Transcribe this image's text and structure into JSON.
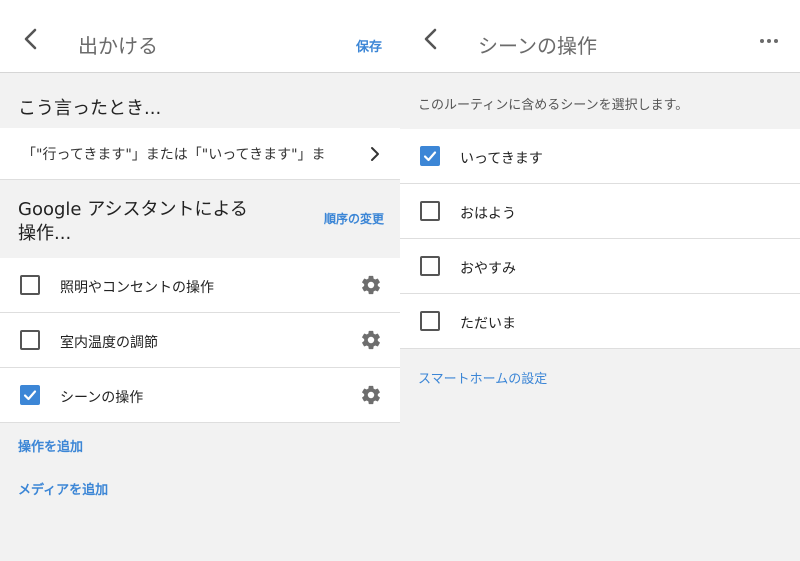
{
  "left": {
    "title": "出かける",
    "save_label": "保存",
    "when_heading": "こう言ったとき...",
    "trigger_text": "「\"行ってきます\"」または「\"いってきます\"」ま",
    "actions_heading_line1": "Google アシスタントによる",
    "actions_heading_line2": "操作...",
    "reorder_label": "順序の変更",
    "actions": [
      {
        "label": "照明やコンセントの操作",
        "checked": false
      },
      {
        "label": "室内温度の調節",
        "checked": false
      },
      {
        "label": "シーンの操作",
        "checked": true
      }
    ],
    "add_action_label": "操作を追加",
    "add_media_label": "メディアを追加"
  },
  "right": {
    "title": "シーンの操作",
    "intro": "このルーティンに含めるシーンを選択します。",
    "scenes": [
      {
        "label": "いってきます",
        "checked": true
      },
      {
        "label": "おはよう",
        "checked": false
      },
      {
        "label": "おやすみ",
        "checked": false
      },
      {
        "label": "ただいま",
        "checked": false
      }
    ],
    "smarthome_link": "スマートホームの設定"
  },
  "colors": {
    "accent": "#3c86d6",
    "background": "#f2f2f2",
    "card": "#ffffff",
    "title_text": "#6b6b6b"
  },
  "icons": [
    "back-arrow-icon",
    "more-vert-icon",
    "chevron-right-icon",
    "gear-icon",
    "checkmark-icon"
  ]
}
